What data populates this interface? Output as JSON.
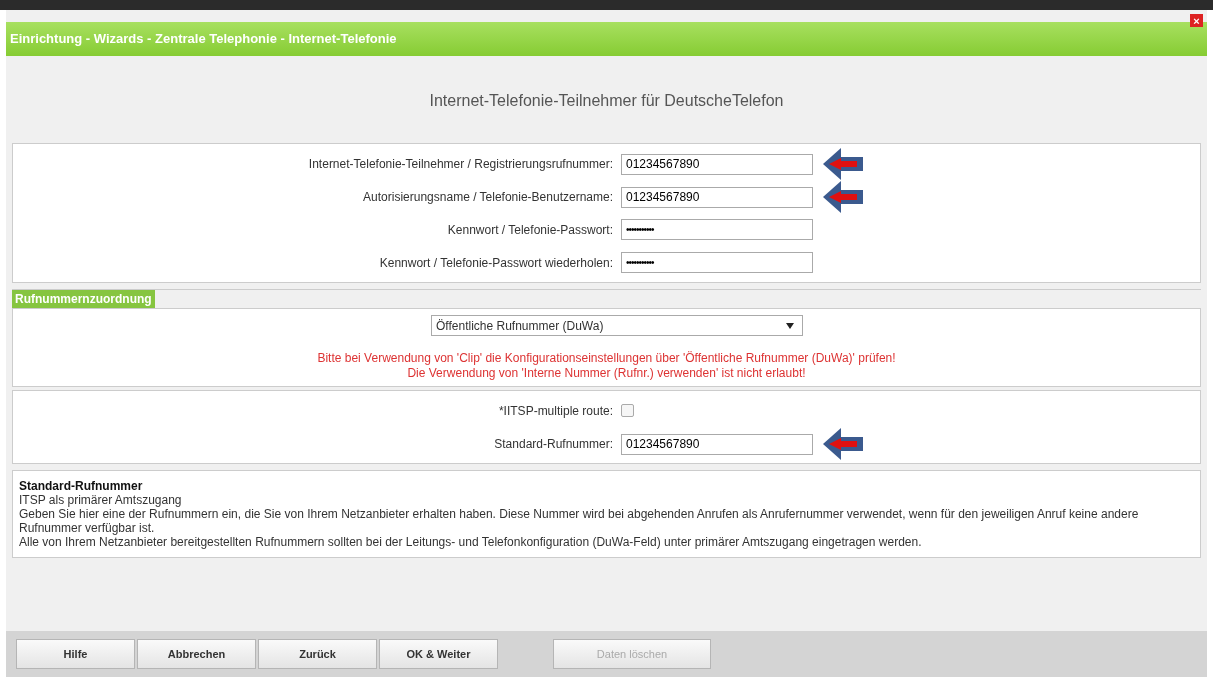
{
  "window": {
    "title": "Einrichtung - Wizards - Zentrale Telephonie - Internet-Telefonie",
    "close": "×"
  },
  "heading": "Internet-Telefonie-Teilnehmer für DeutscheTelefon",
  "account_fields": [
    {
      "label": "Internet-Telefonie-Teilnehmer / Registrierungsrufnummer:",
      "kind": "text",
      "value": "01234567890",
      "highlighted": true
    },
    {
      "label": "Autorisierungsname / Telefonie-Benutzername:",
      "kind": "text",
      "value": "01234567890",
      "highlighted": true
    },
    {
      "label": "Kennwort / Telefonie-Passwort:",
      "kind": "password",
      "value": "•••••••••••",
      "highlighted": false
    },
    {
      "label": "Kennwort / Telefonie-Passwort wiederholen:",
      "kind": "password",
      "value": "•••••••••••",
      "highlighted": false
    }
  ],
  "number_assignment": {
    "section_title": "Rufnummernzuordnung",
    "select_value": "Öffentliche Rufnummer (DuWa)",
    "warnings": [
      "Bitte bei Verwendung von 'Clip' die Konfigurationseinstellungen über 'Öffentliche Rufnummer (DuWa)' prüfen!",
      "Die Verwendung von 'Interne Nummer (Rufnr.) verwenden' ist nicht erlaubt!"
    ]
  },
  "routing_fields": [
    {
      "label": "*IITSP-multiple route:",
      "kind": "checkbox",
      "checked": false,
      "highlighted": false
    },
    {
      "label": "Standard-Rufnummer:",
      "kind": "text",
      "value": "01234567890",
      "highlighted": true
    }
  ],
  "help": {
    "title": "Standard-Rufnummer",
    "lines": [
      "ITSP als primärer Amtszugang",
      "Geben Sie hier eine der Rufnummern ein, die Sie von Ihrem Netzanbieter erhalten haben. Diese Nummer wird bei abgehenden Anrufen als Anrufernummer verwendet, wenn für den jeweiligen Anruf keine andere Rufnummer verfügbar ist.",
      "Alle von Ihrem Netzanbieter bereitgestellten Rufnummern sollten bei der Leitungs- und Telefonkonfiguration (DuWa-Feld) unter primärer Amtszugang eingetragen werden."
    ]
  },
  "buttons": [
    {
      "label": "Hilfe",
      "disabled": false
    },
    {
      "label": "Abbrechen",
      "disabled": false
    },
    {
      "label": "Zurück",
      "disabled": false
    },
    {
      "label": "OK & Weiter",
      "disabled": false
    },
    {
      "label": "Daten löschen",
      "disabled": true
    }
  ]
}
